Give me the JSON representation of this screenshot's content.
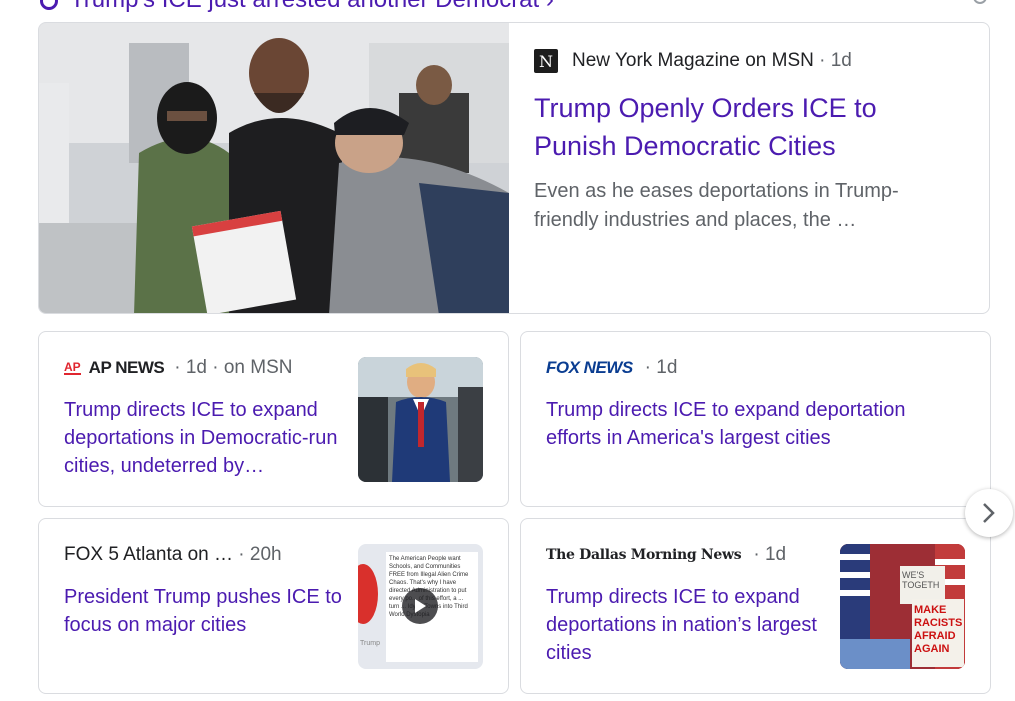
{
  "top_heading": "Trump's ICE just arrested another Democrat",
  "hero": {
    "source": "New York Magazine on MSN",
    "age": "· 1d",
    "title": "Trump Openly Orders ICE to Punish Democratic Cities",
    "snippet": "Even as he eases deportations in Trump-friendly industries and places, the …"
  },
  "cards": [
    {
      "logo_prefix": "AP",
      "logo_text": "AP NEWS",
      "meta": "· 1d · on MSN",
      "title": "Trump directs ICE to expand deportations in Democratic-run cities, undeterred by…"
    },
    {
      "logo_text": "FOX NEWS",
      "meta": "· 1d",
      "title": "Trump directs ICE to expand deportation efforts in America's largest cities"
    },
    {
      "source": "FOX 5 Atlanta on …",
      "meta": "· 20h",
      "title": "President Trump pushes ICE to focus on major cities",
      "thumb_text": "The American People want Schools, and Communities FREE from Illegal Alien Crime Chaos. That's why I have directed Administration to put every po... of this effort, a ... turn ... Idyllic Towns into Third World Dystopia",
      "thumb_sig": "Trump"
    },
    {
      "logo_text": "The Dallas Morning News",
      "meta": "· 1d",
      "title": "Trump directs ICE to expand deportations in nation’s largest cities",
      "thumb_sign1": "WE'S TOGETH",
      "thumb_sign2": "MAKE RACISTS AFRAID AGAIN"
    }
  ],
  "colors": {
    "link": "#4b1bb0",
    "meta": "#5f6368",
    "border": "#dadce0"
  },
  "icons": {
    "next": "chevron-right-icon",
    "play": "play-icon"
  }
}
